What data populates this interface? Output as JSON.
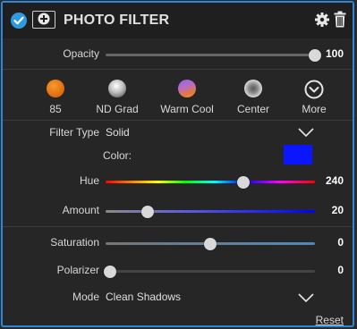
{
  "header": {
    "title": "PHOTO FILTER",
    "enabled": true
  },
  "opacity": {
    "label": "Opacity",
    "value": "100",
    "level": 1.0
  },
  "presets": [
    {
      "label": "85",
      "icon": "orange-filter-icon"
    },
    {
      "label": "ND Grad",
      "icon": "gray-filter-icon"
    },
    {
      "label": "Warm Cool",
      "icon": "warm-cool-filter-icon"
    },
    {
      "label": "Center",
      "icon": "center-filter-icon"
    },
    {
      "label": "More",
      "icon": "chevron-down-circle-icon"
    }
  ],
  "filter_type": {
    "label": "Filter Type",
    "value": "Solid"
  },
  "color": {
    "label": "Color:",
    "hex": "#0b16ff"
  },
  "hue": {
    "label": "Hue",
    "value": "240",
    "level": 0.66
  },
  "amount": {
    "label": "Amount",
    "value": "20",
    "level": 0.2
  },
  "saturation": {
    "label": "Saturation",
    "value": "0",
    "level": 0.5
  },
  "polarizer": {
    "label": "Polarizer",
    "value": "0",
    "level": 0.0
  },
  "mode": {
    "label": "Mode",
    "value": "Clean Shadows"
  },
  "reset_label": "Reset",
  "colors": {
    "accent": "#2f86d6",
    "panel": "#262626"
  }
}
